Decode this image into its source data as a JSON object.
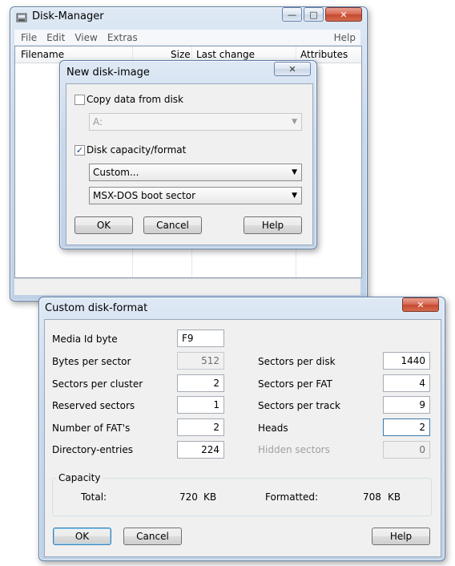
{
  "main_window": {
    "title": "Disk-Manager",
    "menu": [
      "File",
      "Edit",
      "View",
      "Extras"
    ],
    "menu_help": "Help",
    "columns": {
      "filename": "Filename",
      "size": "Size",
      "last_change": "Last change",
      "attributes": "Attributes"
    }
  },
  "new_disk_dialog": {
    "title": "New disk-image",
    "close_glyph": "✕",
    "copy_from_disk": {
      "label": "Copy data from disk",
      "checked": false
    },
    "drive_select": {
      "value": "A:"
    },
    "capacity_format": {
      "label": "Disk capacity/format",
      "checked": true,
      "check_glyph": "✓"
    },
    "format_select": {
      "value": "Custom..."
    },
    "bootsector_select": {
      "value": "MSX-DOS boot sector"
    },
    "buttons": {
      "ok": "OK",
      "cancel": "Cancel",
      "help": "Help"
    }
  },
  "custom_format_dialog": {
    "title": "Custom disk-format",
    "close_glyph": "✕",
    "fields": {
      "media_id_label": "Media Id byte",
      "media_id_value": "F9",
      "bytes_per_sector_label": "Bytes per sector",
      "bytes_per_sector_value": "512",
      "sectors_per_cluster_label": "Sectors per cluster",
      "sectors_per_cluster_value": "2",
      "reserved_sectors_label": "Reserved sectors",
      "reserved_sectors_value": "1",
      "number_of_fats_label": "Number of FAT's",
      "number_of_fats_value": "2",
      "directory_entries_label": "Directory-entries",
      "directory_entries_value": "224",
      "sectors_per_disk_label": "Sectors per disk",
      "sectors_per_disk_value": "1440",
      "sectors_per_fat_label": "Sectors per FAT",
      "sectors_per_fat_value": "4",
      "sectors_per_track_label": "Sectors per track",
      "sectors_per_track_value": "9",
      "heads_label": "Heads",
      "heads_value": "2",
      "hidden_sectors_label": "Hidden sectors",
      "hidden_sectors_value": "0"
    },
    "capacity": {
      "group_label": "Capacity",
      "total_label": "Total:",
      "total_value": "720",
      "total_unit": "KB",
      "formatted_label": "Formatted:",
      "formatted_value": "708",
      "formatted_unit": "KB"
    },
    "buttons": {
      "ok": "OK",
      "cancel": "Cancel",
      "help": "Help"
    }
  },
  "window_controls": {
    "minimize": "—",
    "maximize": "□",
    "close": "✕"
  }
}
